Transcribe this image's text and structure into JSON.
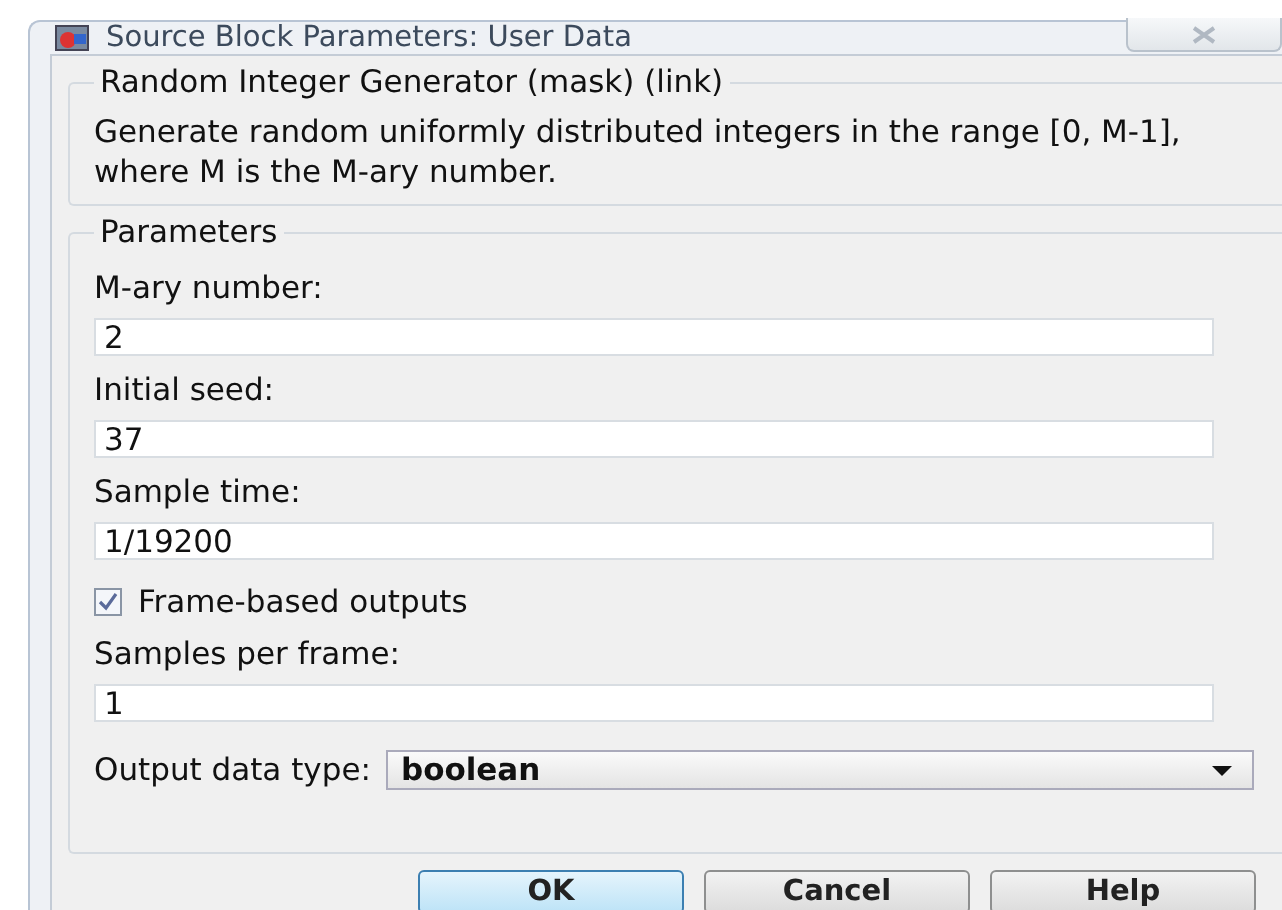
{
  "window": {
    "title": "Source Block Parameters: User Data"
  },
  "block": {
    "title": "Random Integer Generator (mask) (link)",
    "description": "Generate random uniformly distributed integers in the range [0, M-1], where M is the M-ary number."
  },
  "parameters": {
    "title": "Parameters",
    "items": [
      {
        "kind": "text",
        "label": "M-ary number:",
        "value": "2"
      },
      {
        "kind": "text",
        "label": "Initial seed:",
        "value": "37"
      },
      {
        "kind": "text",
        "label": "Sample time:",
        "value": "1/19200"
      },
      {
        "kind": "checkbox",
        "label": "Frame-based outputs",
        "checked": true
      },
      {
        "kind": "text",
        "label": "Samples per frame:",
        "value": "1"
      },
      {
        "kind": "select",
        "label": "Output data type:",
        "value": "boolean"
      }
    ]
  },
  "buttons": [
    {
      "label": "OK",
      "selected": true
    },
    {
      "label": "Cancel",
      "selected": false
    },
    {
      "label": "Help",
      "selected": false
    }
  ]
}
